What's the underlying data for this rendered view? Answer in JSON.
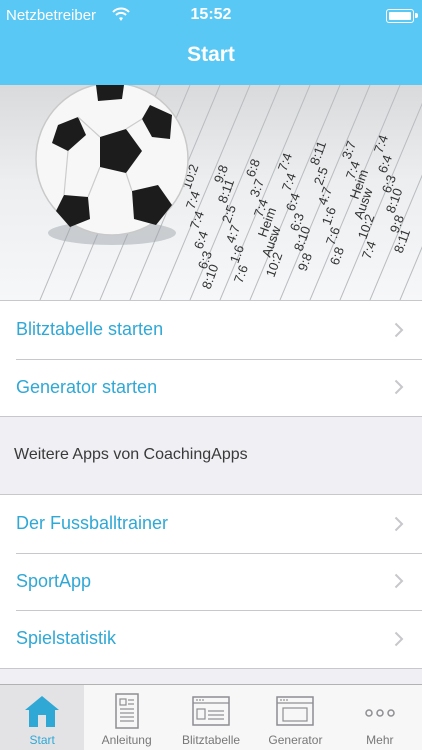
{
  "status_bar": {
    "carrier": "Netzbetreiber",
    "time": "15:52"
  },
  "nav": {
    "title": "Start"
  },
  "hero": {
    "image_description_icon": "soccer-ball-on-newspaper",
    "table_text": [
      "10:2",
      "7:4",
      "7:4",
      "6:4",
      "6:3",
      "8:10",
      "9:8",
      "8:11",
      "2:5",
      "4:7",
      "1:6",
      "7:6",
      "6:8",
      "3:7",
      "7:4",
      "Heim",
      "Ausw"
    ]
  },
  "primary_items": [
    {
      "label": "Blitztabelle starten"
    },
    {
      "label": "Generator starten"
    }
  ],
  "section": {
    "title": "Weitere Apps von CoachingApps"
  },
  "apps_items": [
    {
      "label": "Der Fussballtrainer"
    },
    {
      "label": "SportApp"
    },
    {
      "label": "Spielstatistik"
    }
  ],
  "tabbar": {
    "tabs": [
      {
        "label": "Start",
        "icon": "home-icon",
        "active": true
      },
      {
        "label": "Anleitung",
        "icon": "document-icon",
        "active": false
      },
      {
        "label": "Blitztabelle",
        "icon": "table-window-icon",
        "active": false
      },
      {
        "label": "Generator",
        "icon": "window-icon",
        "active": false
      },
      {
        "label": "Mehr",
        "icon": "more-icon",
        "active": false
      }
    ]
  },
  "colors": {
    "accent": "#5ac8f5",
    "link": "#2fa8d6",
    "background": "#efeff4"
  }
}
